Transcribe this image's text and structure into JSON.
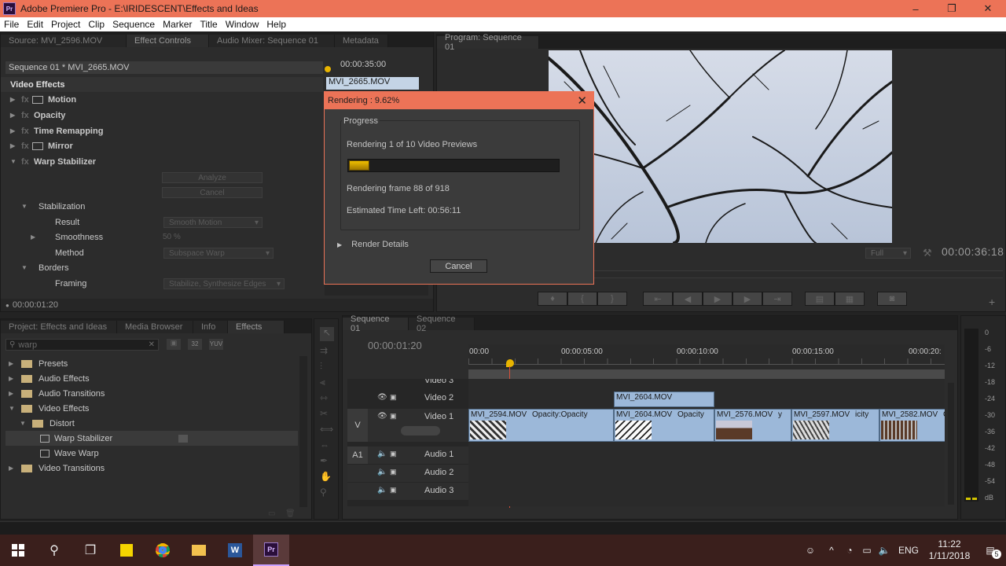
{
  "window": {
    "title": "Adobe Premiere Pro - E:\\IRIDESCENT\\Effects and Ideas",
    "minimize": "–",
    "maximize": "❐",
    "close": "✕"
  },
  "menu": [
    "File",
    "Edit",
    "Project",
    "Clip",
    "Sequence",
    "Marker",
    "Title",
    "Window",
    "Help"
  ],
  "source_panel": {
    "tabs": [
      "Source: MVI_2596.MOV",
      "Effect Controls",
      "Audio Mixer: Sequence 01",
      "Metadata"
    ],
    "sequence_label": "Sequence 01 * MVI_2665.MOV",
    "mini_timecode": "00:00:35:00",
    "mini_clip": "MVI_2665.MOV",
    "section": "Video Effects",
    "effects": [
      {
        "label": "Motion",
        "icon": true
      },
      {
        "label": "Opacity",
        "icon": false
      },
      {
        "label": "Time Remapping",
        "icon": false
      },
      {
        "label": "Mirror",
        "icon": true
      },
      {
        "label": "Warp Stabilizer",
        "icon": false
      }
    ],
    "analyze_label": "Analyze",
    "cancel_label": "Cancel",
    "stabilization_label": "Stabilization",
    "result_label": "Result",
    "result_value": "Smooth Motion",
    "smoothness_label": "Smoothness",
    "smoothness_value": "50 %",
    "method_label": "Method",
    "method_value": "Subspace Warp",
    "borders_label": "Borders",
    "framing_label": "Framing",
    "framing_value": "Stabilize, Synthesize Edges",
    "footer_timecode": "00:00:01:20"
  },
  "dialog": {
    "title": "Rendering : 9.62%",
    "close": "✕",
    "group_label": "Progress",
    "line1": "Rendering 1 of 10 Video Previews",
    "progress": 0.0962,
    "line2": "Rendering frame 88 of 918",
    "line3": "Estimated Time Left: 00:56:11",
    "details_label": "Render Details",
    "cancel_label": "Cancel"
  },
  "program": {
    "tab": "Program: Sequence 01",
    "fit_label": "Full",
    "timecode": "00:00:36:18"
  },
  "project_panel": {
    "tabs": [
      "Project: Effects and Ideas",
      "Media Browser",
      "Info",
      "Effects"
    ],
    "search_value": "warp",
    "tree": [
      {
        "label": "Presets",
        "level": 0,
        "expanded": false
      },
      {
        "label": "Audio Effects",
        "level": 0,
        "expanded": false
      },
      {
        "label": "Audio Transitions",
        "level": 0,
        "expanded": false
      },
      {
        "label": "Video Effects",
        "level": 0,
        "expanded": true
      },
      {
        "label": "Distort",
        "level": 1,
        "expanded": true
      },
      {
        "label": "Warp Stabilizer",
        "level": 2,
        "selected": true
      },
      {
        "label": "Wave Warp",
        "level": 2
      },
      {
        "label": "Video Transitions",
        "level": 0,
        "expanded": false
      }
    ]
  },
  "timeline": {
    "tabs": [
      "Sequence 01",
      "Sequence 02"
    ],
    "timecode": "00:00:01:20",
    "ruler": [
      "00:00",
      "00:00:05:00",
      "00:00:10:00",
      "00:00:15:00",
      "00:00:20:"
    ],
    "tracks": {
      "video3": "Video 3",
      "video2": "Video 2",
      "video1": "Video 1",
      "v_label": "V",
      "a1_label": "A1",
      "audio1": "Audio 1",
      "audio2": "Audio 2",
      "audio3": "Audio 3"
    },
    "clips_v2": [
      {
        "name": "MVI_2604.MOV"
      }
    ],
    "clips_v1": [
      {
        "name": "MVI_2594.MOV",
        "fx": "Opacity:Opacity"
      },
      {
        "name": "MVI_2604.MOV",
        "fx": "Opacity"
      },
      {
        "name": "MVI_2576.MOV",
        "fx": "y"
      },
      {
        "name": "MVI_2597.MOV",
        "fx": "icity"
      },
      {
        "name": "MVI_2582.MOV",
        "fx": "C"
      }
    ]
  },
  "meter": {
    "labels": [
      "0",
      "-6",
      "-12",
      "-18",
      "-24",
      "-30",
      "-36",
      "-42",
      "-48",
      "-54",
      "dB"
    ]
  },
  "taskbar": {
    "language": "ENG",
    "time": "11:22",
    "date": "1/11/2018",
    "notifications": "5"
  }
}
